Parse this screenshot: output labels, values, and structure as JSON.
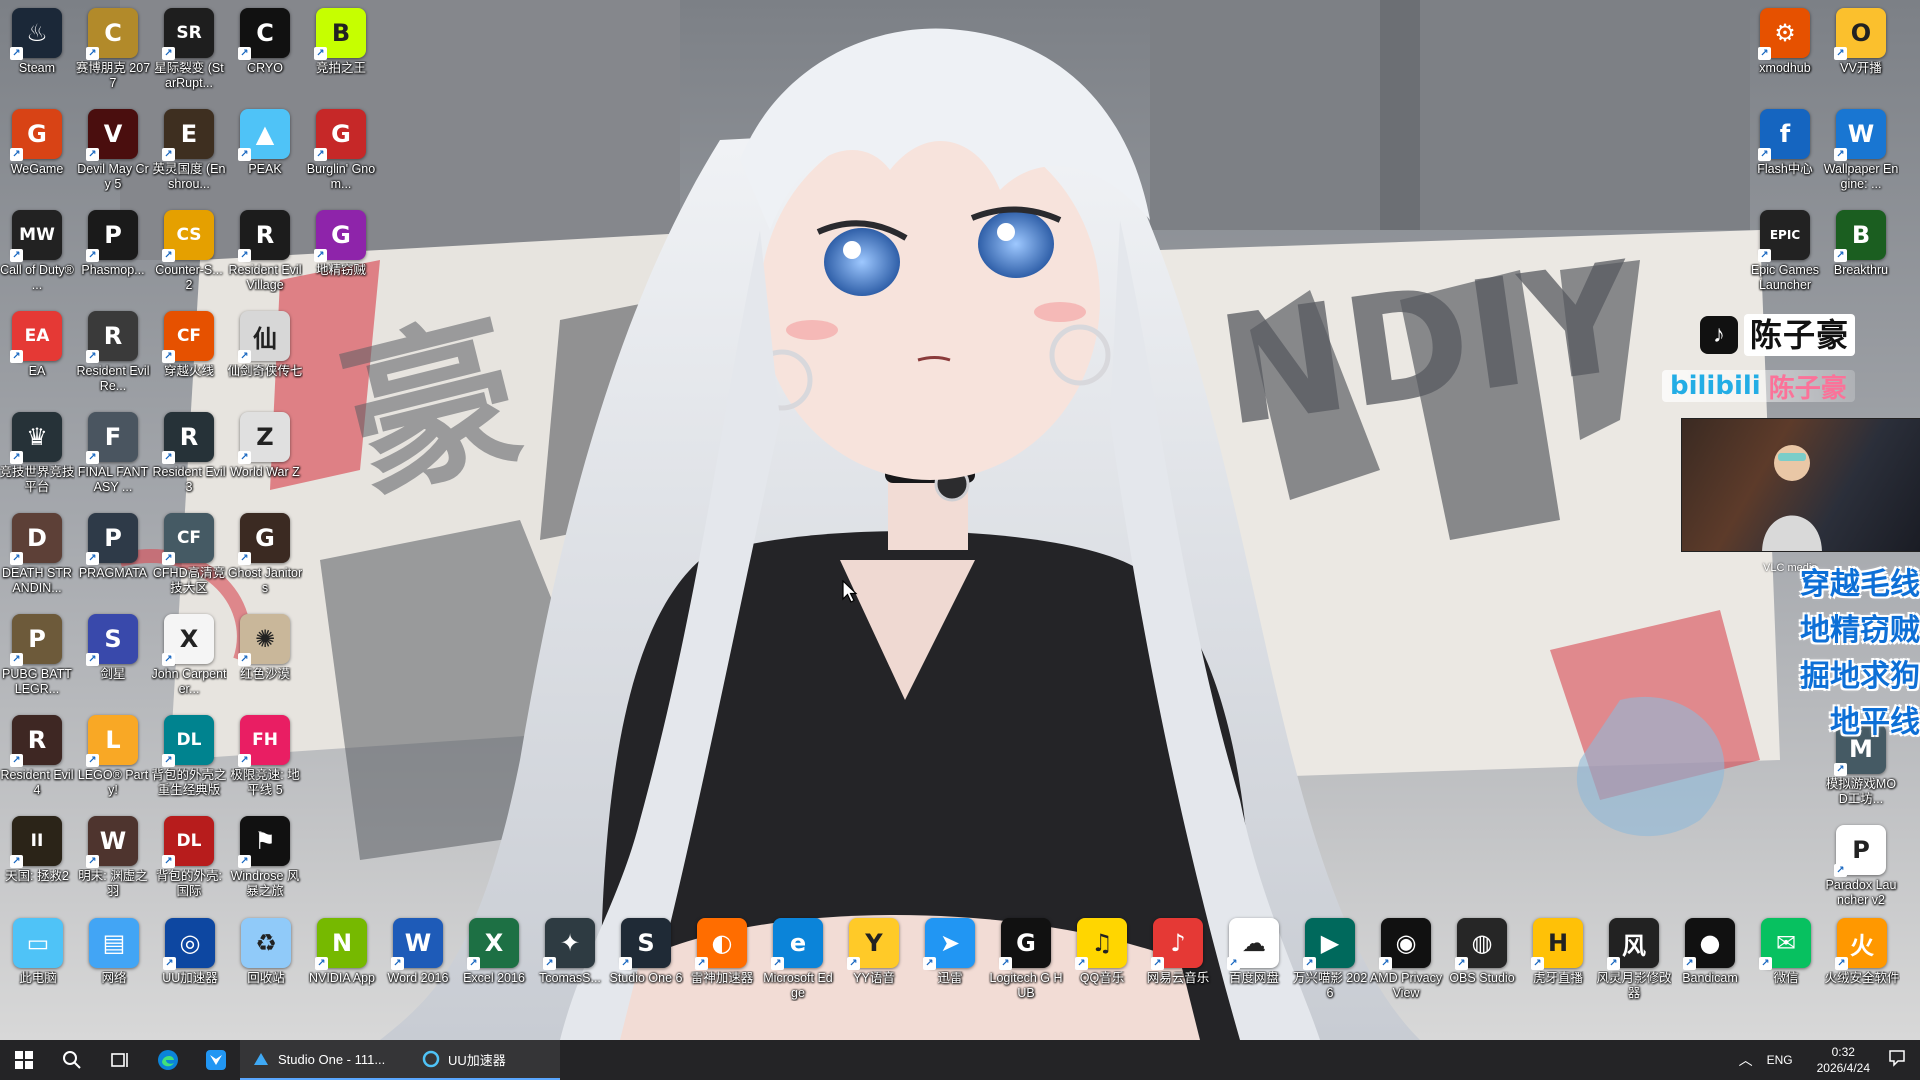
{
  "desktop": {
    "columns": [
      [
        {
          "label": "Steam",
          "bg": "#1b2838",
          "glyph": "♨"
        },
        {
          "label": "WeGame",
          "bg": "#d84315",
          "glyph": "G"
        },
        {
          "label": "Call of Duty® ...",
          "bg": "#222222",
          "glyph": "MW"
        },
        {
          "label": "EA",
          "bg": "#e53935",
          "glyph": "EA"
        },
        {
          "label": "竞技世界竞技平台",
          "bg": "#263238",
          "glyph": "♛"
        },
        {
          "label": "DEATH STRANDIN...",
          "bg": "#5d4037",
          "glyph": "D"
        },
        {
          "label": "PUBG BATTLEGR...",
          "bg": "#6d5a3a",
          "glyph": "P"
        },
        {
          "label": "Resident Evil 4",
          "bg": "#3e2723",
          "glyph": "R"
        },
        {
          "label": "天国: 拯救2",
          "bg": "#2b2418",
          "glyph": "II"
        }
      ],
      [
        {
          "label": "赛博朋克 2077",
          "bg": "#b28a2a",
          "glyph": "C"
        },
        {
          "label": "Devil May Cry 5",
          "bg": "#4a0e0e",
          "glyph": "V"
        },
        {
          "label": "Phasmop...",
          "bg": "#1a1a1a",
          "glyph": "P"
        },
        {
          "label": "Resident Evil Re...",
          "bg": "#3a3a3a",
          "glyph": "R"
        },
        {
          "label": "FINAL FANTASY ...",
          "bg": "#4a5560",
          "glyph": "F"
        },
        {
          "label": "PRAGMATA",
          "bg": "#2e3a48",
          "glyph": "P"
        },
        {
          "label": "剑星",
          "bg": "#3949ab",
          "glyph": "S"
        },
        {
          "label": "LEGO® Party!",
          "bg": "#f9a825",
          "glyph": "L"
        },
        {
          "label": "明末: 渊虚之羽",
          "bg": "#4e342e",
          "glyph": "W"
        }
      ],
      [
        {
          "label": "星际裂变 (StarRupt...",
          "bg": "#1e1e1e",
          "glyph": "SR"
        },
        {
          "label": "英灵国度 (Enshrou...",
          "bg": "#3e2f20",
          "glyph": "E"
        },
        {
          "label": "Counter-S... 2",
          "bg": "#e5a000",
          "glyph": "CS"
        },
        {
          "label": "穿越火线",
          "bg": "#e65100",
          "glyph": "CF"
        },
        {
          "label": "Resident Evil 3",
          "bg": "#263238",
          "glyph": "R"
        },
        {
          "label": "CFHD高清竞技大区",
          "bg": "#455a64",
          "glyph": "CF"
        },
        {
          "label": "John Carpenter...",
          "bg": "#f5f5f5",
          "glyph": "X"
        },
        {
          "label": "背包的外壳之 重生经典版",
          "bg": "#00838f",
          "glyph": "DL"
        },
        {
          "label": "背包的外壳: 国际",
          "bg": "#b71c1c",
          "glyph": "DL"
        }
      ],
      [
        {
          "label": "CRYO",
          "bg": "#111111",
          "glyph": "C"
        },
        {
          "label": "PEAK",
          "bg": "#4fc3f7",
          "glyph": "▲"
        },
        {
          "label": "Resident Evil Village",
          "bg": "#1c1c1c",
          "glyph": "R"
        },
        {
          "label": "仙剑奇侠传七",
          "bg": "#d7d7d7",
          "glyph": "仙"
        },
        {
          "label": "World War Z",
          "bg": "#e0e0e0",
          "glyph": "Z"
        },
        {
          "label": "Ghost Janitors",
          "bg": "#3b2a22",
          "glyph": "G"
        },
        {
          "label": "红色沙漠",
          "bg": "#c9b79a",
          "glyph": "✺"
        },
        {
          "label": "极限竞速: 地平线 5",
          "bg": "#e91e63",
          "glyph": "FH"
        },
        {
          "label": "Windrose 风暴之旅",
          "bg": "#111111",
          "glyph": "⚑"
        }
      ],
      [
        {
          "label": "竞拍之王",
          "bg": "#c6ff00",
          "glyph": "B"
        },
        {
          "label": "Burglin' Gnom...",
          "bg": "#c62828",
          "glyph": "G"
        },
        {
          "label": "地精窃贼",
          "bg": "#8e24aa",
          "glyph": "G"
        }
      ]
    ],
    "right_columns": [
      [
        {
          "label": "xmodhub",
          "bg": "#e65100",
          "glyph": "⚙"
        },
        {
          "label": "Flash中心",
          "bg": "#1565c0",
          "glyph": "f"
        },
        {
          "label": "Epic Games Launcher",
          "bg": "#222222",
          "glyph": "EPIC"
        }
      ],
      [
        {
          "label": "VV开播",
          "bg": "#fbc02d",
          "glyph": "O"
        },
        {
          "label": "Wallpaper Engine: ...",
          "bg": "#1976d2",
          "glyph": "W"
        },
        {
          "label": "Breakthru",
          "bg": "#1b5e20",
          "glyph": "B"
        }
      ]
    ],
    "right_lower": [
      {
        "label": "模拟游戏MOD工坊...",
        "bg": "#455a64",
        "glyph": "M"
      },
      {
        "label": "Paradox Launcher v2",
        "bg": "#ffffff",
        "glyph": "P"
      }
    ],
    "bottom_row": [
      {
        "label": "此电脑",
        "bg": "#4fc3f7",
        "glyph": "▭",
        "arrow": false
      },
      {
        "label": "网络",
        "bg": "#42a5f5",
        "glyph": "▤",
        "arrow": false
      },
      {
        "label": "UU加速器",
        "bg": "#0d47a1",
        "glyph": "◎"
      },
      {
        "label": "回收站",
        "bg": "#90caf9",
        "glyph": "♻",
        "arrow": false
      },
      {
        "label": "NVIDIA App",
        "bg": "#76b900",
        "glyph": "N"
      },
      {
        "label": "Word 2016",
        "bg": "#1e5bb8",
        "glyph": "W"
      },
      {
        "label": "Excel 2016",
        "bg": "#1d7044",
        "glyph": "X"
      },
      {
        "label": "TcomasS...",
        "bg": "#2e3b42",
        "glyph": "✦"
      },
      {
        "label": "Studio One 6",
        "bg": "#1f2a36",
        "glyph": "S"
      },
      {
        "label": "雷神加速器",
        "bg": "#ff6d00",
        "glyph": "◐"
      },
      {
        "label": "Microsoft Edge",
        "bg": "#0b84d9",
        "glyph": "e"
      },
      {
        "label": "YY语音",
        "bg": "#ffca28",
        "glyph": "Y"
      },
      {
        "label": "迅雷",
        "bg": "#2196f3",
        "glyph": "➤"
      },
      {
        "label": "Logitech G HUB",
        "bg": "#111111",
        "glyph": "G"
      },
      {
        "label": "QQ音乐",
        "bg": "#ffd600",
        "glyph": "♫"
      },
      {
        "label": "网易云音乐",
        "bg": "#e53935",
        "glyph": "♪"
      },
      {
        "label": "百度网盘",
        "bg": "#ffffff",
        "glyph": "☁"
      },
      {
        "label": "万兴喵影 2026",
        "bg": "#00695c",
        "glyph": "▶"
      },
      {
        "label": "AMD Privacy View",
        "bg": "#111111",
        "glyph": "◉"
      },
      {
        "label": "OBS Studio",
        "bg": "#262626",
        "glyph": "◍"
      },
      {
        "label": "虎牙直播",
        "bg": "#ffc107",
        "glyph": "H"
      },
      {
        "label": "风灵月影修改器",
        "bg": "#222222",
        "glyph": "风"
      },
      {
        "label": "Bandicam",
        "bg": "#111111",
        "glyph": "●"
      },
      {
        "label": "微信",
        "bg": "#07c160",
        "glyph": "✉"
      },
      {
        "label": "火绒安全软件",
        "bg": "#ff9800",
        "glyph": "火"
      }
    ],
    "overlay": {
      "tiktok_name": "陈子豪",
      "bili_logo": "bilibili",
      "bili_name": "陈子豪",
      "cam_label": "VLC media",
      "games": [
        "穿越毛线",
        "地精窃贼",
        "掘地求狗",
        "地平线"
      ]
    }
  },
  "taskbar": {
    "apps": [
      {
        "label": "Studio One - 111...",
        "open": true
      },
      {
        "label": "UU加速器",
        "open": true
      }
    ],
    "lang": "ENG",
    "time": "0:32",
    "date": "2026/4/24"
  }
}
